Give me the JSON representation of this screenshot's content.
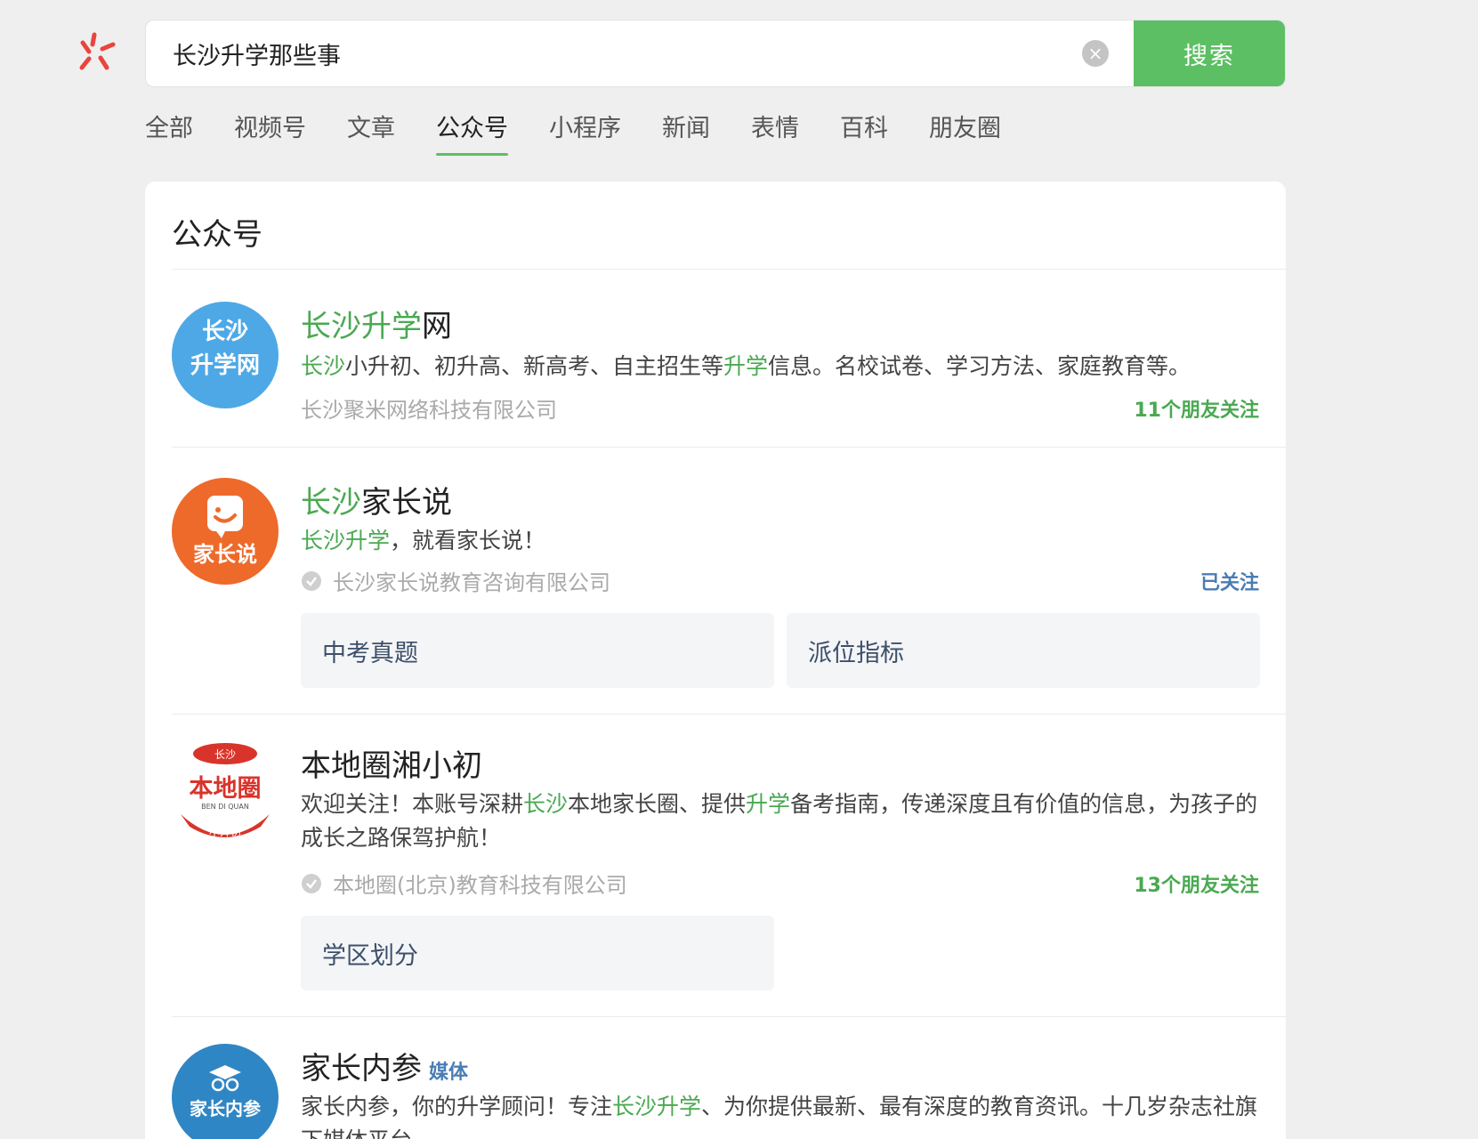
{
  "search": {
    "query": "长沙升学那些事",
    "button": "搜索"
  },
  "tabs": [
    "全部",
    "视频号",
    "文章",
    "公众号",
    "小程序",
    "新闻",
    "表情",
    "百科",
    "朋友圈"
  ],
  "results": {
    "section_title": "公众号",
    "items": [
      {
        "name_hl": "长沙升学",
        "name_rest": "网",
        "avatar_text": [
          "长沙",
          "升学网"
        ],
        "desc_parts": [
          "长沙",
          "小升初、初升高、新高考、自主招生等",
          "升学",
          "信息。名校试卷、学习方法、家庭教育等。"
        ],
        "company": "长沙聚米网络科技有限公司",
        "follow": "11个朋友关注"
      },
      {
        "name_hl": "长沙",
        "name_rest": "家长说",
        "avatar_text": [
          "家长说"
        ],
        "desc_parts": [
          "长沙升学",
          "，就看家长说！"
        ],
        "company": "长沙家长说教育咨询有限公司",
        "follow": "已关注",
        "menus": [
          "中考真题",
          "派位指标"
        ]
      },
      {
        "name": "本地圈湘小初",
        "avatar_text": [
          "长沙",
          "本地圈",
          "BEN DI QUAN",
          "小升初"
        ],
        "desc_parts": [
          "欢迎关注！本账号深耕",
          "长沙",
          "本地家长圈、提供",
          "升学",
          "备考指南，传递深度且有价值的信息，为孩子的成长之路保驾护航！"
        ],
        "company": "本地圈(北京)教育科技有限公司",
        "follow": "13个朋友关注",
        "menus": [
          "学区划分"
        ]
      },
      {
        "name": "家长内参",
        "badge": "媒体",
        "avatar_text": [
          "家长内参"
        ],
        "desc_parts": [
          "家长内参，你的升学顾问！专注",
          "长沙升学",
          "、为你提供最新、最有深度的教育资讯。十几岁杂志社旗下媒体平台"
        ]
      }
    ]
  },
  "colors": {
    "accent_green": "#5cbf63",
    "highlight_green": "#4aa952",
    "link_blue": "#4a7db4",
    "logo_red": "#e8453c"
  }
}
